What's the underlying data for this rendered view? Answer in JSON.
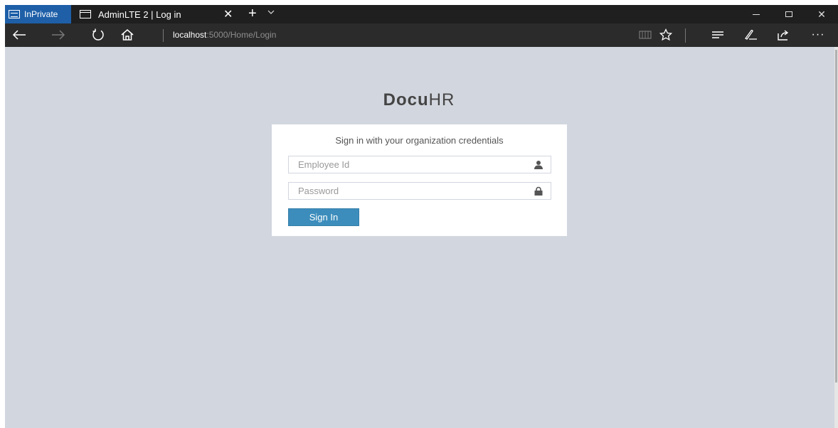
{
  "browser": {
    "inprivate_label": "InPrivate",
    "tab_title": "AdminLTE 2 | Log in",
    "new_tab_symbol": "+",
    "tab_close_symbol": "✕",
    "close_symbol": "✕",
    "more_symbol": "···",
    "address_host": "localhost",
    "address_path": ":5000/Home/Login"
  },
  "page": {
    "logo_bold": "Docu",
    "logo_light": "HR",
    "login_message": "Sign in with your organization credentials",
    "employee_placeholder": "Employee Id",
    "password_placeholder": "Password",
    "signin_label": "Sign In"
  },
  "colors": {
    "page_background": "#d2d6de",
    "primary_button": "#3c8dbc",
    "inprivate_badge": "#1e5fa8"
  },
  "icons": {
    "employee_field": "user-icon",
    "password_field": "lock-icon"
  }
}
